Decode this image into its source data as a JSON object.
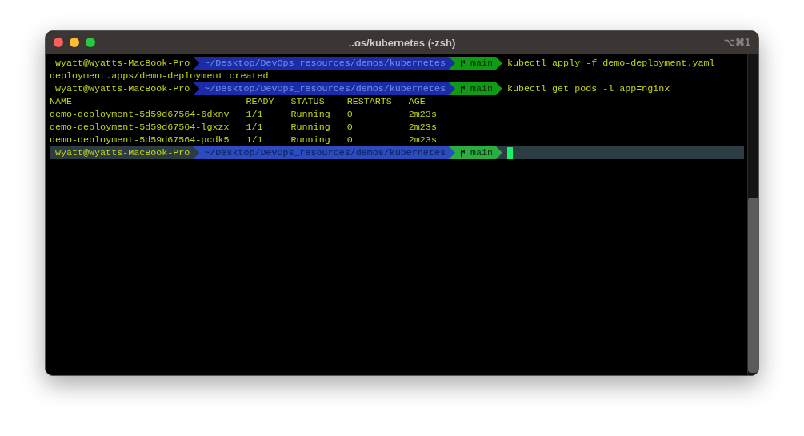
{
  "window": {
    "title": "..os/kubernetes (-zsh)",
    "shortcut": "⌥⌘1"
  },
  "lines": [
    {
      "kind": "prompt",
      "current": false,
      "user": "wyatt@Wyatts-MacBook-Pro",
      "path": "~/Desktop/DevOps_resources/demos/kubernetes",
      "branch": "main",
      "command": "kubectl apply -f demo-deployment.yaml"
    },
    {
      "kind": "output",
      "text": "deployment.apps/demo-deployment created"
    },
    {
      "kind": "prompt",
      "current": false,
      "user": "wyatt@Wyatts-MacBook-Pro",
      "path": "~/Desktop/DevOps_resources/demos/kubernetes",
      "branch": "main",
      "command": "kubectl get pods -l app=nginx"
    },
    {
      "kind": "table",
      "columns": [
        "NAME",
        "READY",
        "STATUS",
        "RESTARTS",
        "AGE"
      ],
      "rows": [
        [
          "demo-deployment-5d59d67564-6dxnv",
          "1/1",
          "Running",
          "0",
          "2m23s"
        ],
        [
          "demo-deployment-5d59d67564-lgxzx",
          "1/1",
          "Running",
          "0",
          "2m23s"
        ],
        [
          "demo-deployment-5d59d67564-pcdk5",
          "1/1",
          "Running",
          "0",
          "2m23s"
        ]
      ]
    },
    {
      "kind": "prompt",
      "current": true,
      "user": "wyatt@Wyatts-MacBook-Pro",
      "path": "~/Desktop/DevOps_resources/demos/kubernetes",
      "branch": "main"
    }
  ]
}
